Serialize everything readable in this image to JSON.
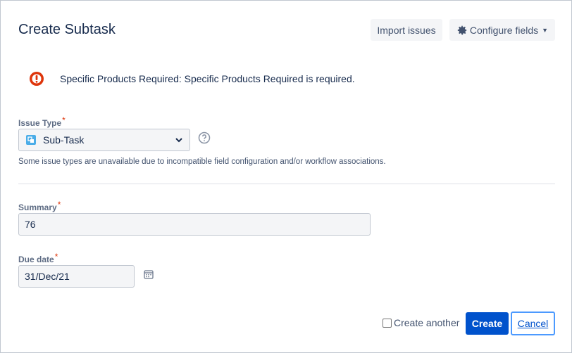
{
  "dialog": {
    "title": "Create Subtask",
    "import_label": "Import issues",
    "configure_label": "Configure fields"
  },
  "error": {
    "message": "Specific Products Required: Specific Products Required is required.",
    "color": "#de350b"
  },
  "issue_type": {
    "label": "Issue Type",
    "required_mark": "*",
    "value": "Sub-Task",
    "hint": "Some issue types are unavailable due to incompatible field configuration and/or workflow associations."
  },
  "summary": {
    "label": "Summary",
    "required_mark": "*",
    "value": "76"
  },
  "due_date": {
    "label": "Due date",
    "required_mark": "*",
    "value": "31/Dec/21"
  },
  "footer": {
    "create_another_label": "Create another",
    "create_another_checked": false,
    "create_label": "Create",
    "cancel_label": "Cancel",
    "primary_color": "#0052cc"
  }
}
